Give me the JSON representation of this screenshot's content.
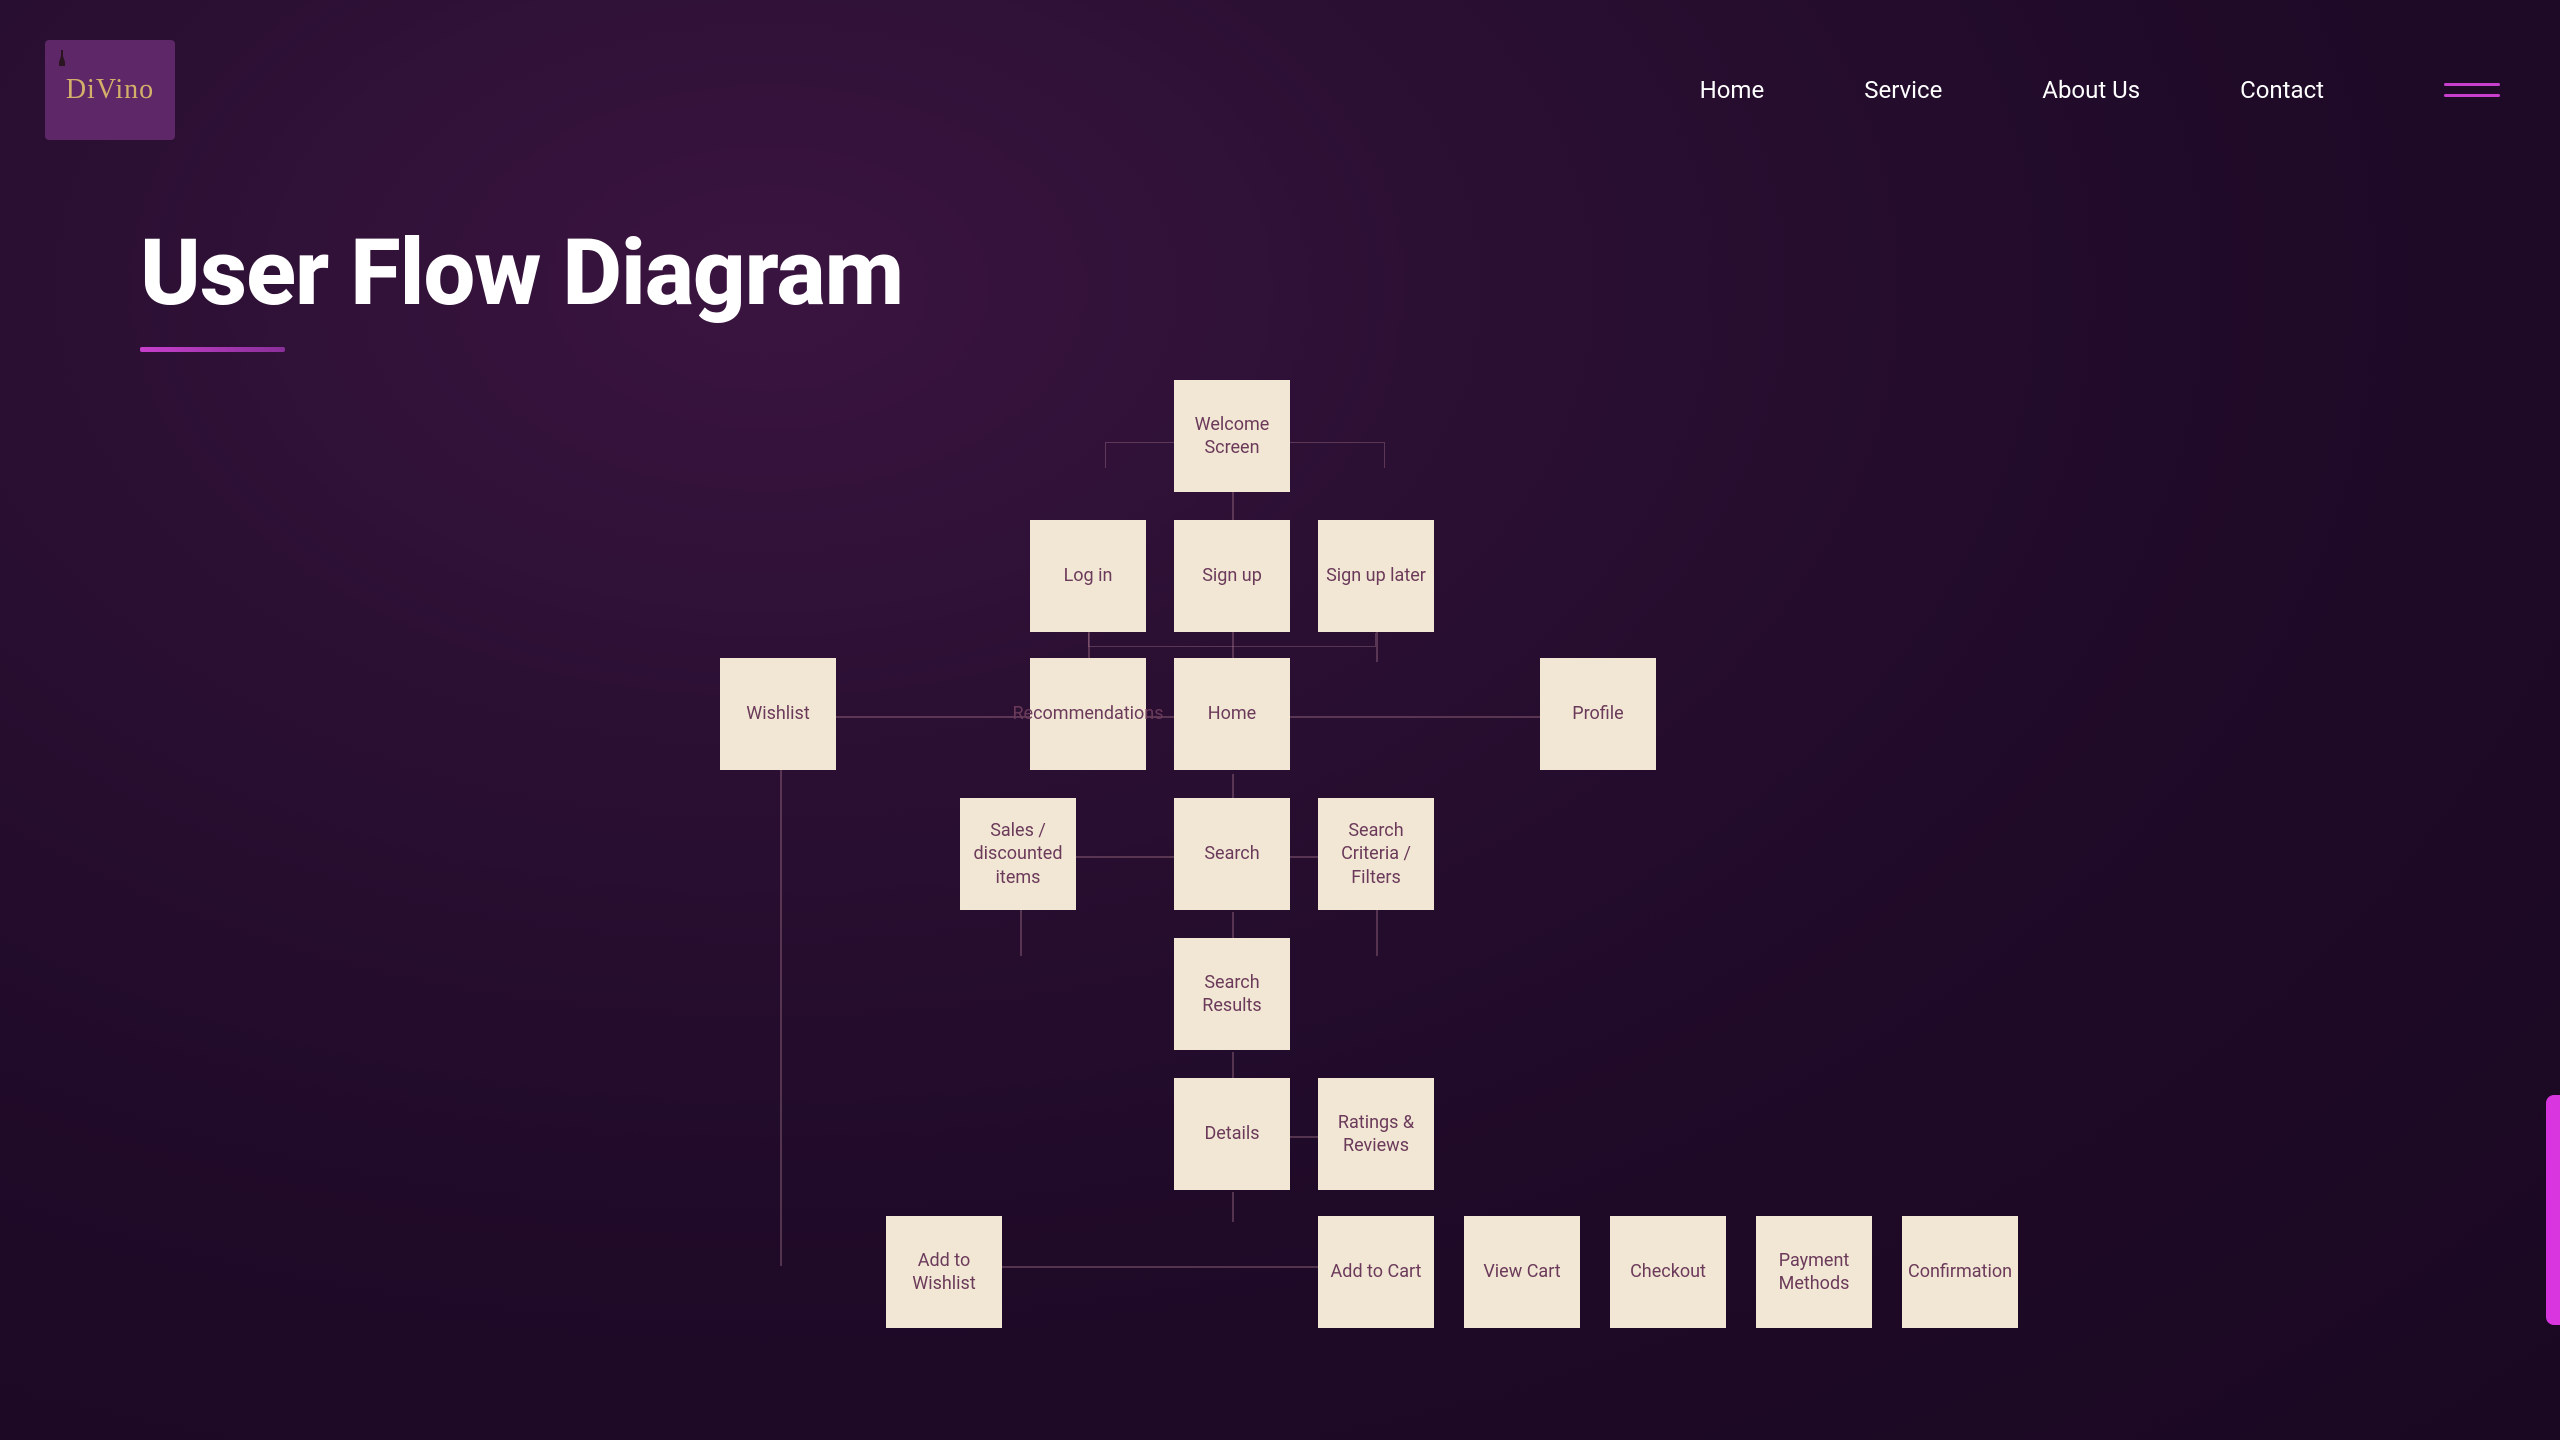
{
  "header": {
    "logo_text": "DiVino",
    "nav": [
      "Home",
      "Service",
      "About Us",
      "Contact"
    ]
  },
  "title": "User Flow Diagram",
  "chart_data": {
    "type": "flowchart",
    "nodes": [
      {
        "id": "welcome",
        "label": "Welcome Screen",
        "row": 0,
        "col": 4
      },
      {
        "id": "login",
        "label": "Log in",
        "row": 1,
        "col": 3
      },
      {
        "id": "signup",
        "label": "Sign up",
        "row": 1,
        "col": 4
      },
      {
        "id": "signuplater",
        "label": "Sign up later",
        "row": 1,
        "col": 5
      },
      {
        "id": "wishlist",
        "label": "Wishlist",
        "row": 2,
        "col": 0
      },
      {
        "id": "recommendations",
        "label": "Recommendations",
        "row": 2,
        "col": 3
      },
      {
        "id": "home",
        "label": "Home",
        "row": 2,
        "col": 4
      },
      {
        "id": "profile",
        "label": "Profile",
        "row": 2,
        "col": 7
      },
      {
        "id": "sales",
        "label": "Sales / discounted items",
        "row": 3,
        "col": 2
      },
      {
        "id": "search",
        "label": "Search",
        "row": 3,
        "col": 4
      },
      {
        "id": "criteria",
        "label": "Search Criteria / Filters",
        "row": 3,
        "col": 5
      },
      {
        "id": "results",
        "label": "Search Results",
        "row": 4,
        "col": 4
      },
      {
        "id": "details",
        "label": "Details",
        "row": 5,
        "col": 4
      },
      {
        "id": "ratings",
        "label": "Ratings & Reviews",
        "row": 5,
        "col": 5
      },
      {
        "id": "addwishlist",
        "label": "Add to Wishlist",
        "row": 6,
        "col": 1
      },
      {
        "id": "addcart",
        "label": "Add to Cart",
        "row": 6,
        "col": 5
      },
      {
        "id": "viewcart",
        "label": "View Cart",
        "row": 6,
        "col": 6
      },
      {
        "id": "checkout",
        "label": "Checkout",
        "row": 6,
        "col": 7
      },
      {
        "id": "payment",
        "label": "Payment Methods",
        "row": 6,
        "col": 8
      },
      {
        "id": "confirmation",
        "label": "Confirmation",
        "row": 6,
        "col": 9
      }
    ],
    "edges": [
      [
        "welcome",
        "login"
      ],
      [
        "welcome",
        "signup"
      ],
      [
        "welcome",
        "signuplater"
      ],
      [
        "login",
        "home"
      ],
      [
        "signup",
        "home"
      ],
      [
        "signuplater",
        "home"
      ],
      [
        "home",
        "wishlist"
      ],
      [
        "home",
        "recommendations"
      ],
      [
        "home",
        "profile"
      ],
      [
        "home",
        "search"
      ],
      [
        "home",
        "sales"
      ],
      [
        "search",
        "criteria"
      ],
      [
        "search",
        "results"
      ],
      [
        "results",
        "details"
      ],
      [
        "details",
        "ratings"
      ],
      [
        "details",
        "addwishlist"
      ],
      [
        "details",
        "addcart"
      ],
      [
        "addcart",
        "viewcart"
      ],
      [
        "viewcart",
        "checkout"
      ],
      [
        "checkout",
        "payment"
      ],
      [
        "payment",
        "confirmation"
      ],
      [
        "addwishlist",
        "wishlist"
      ]
    ]
  }
}
